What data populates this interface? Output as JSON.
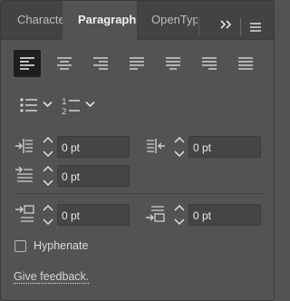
{
  "tabs": {
    "character": "Characte",
    "paragraph": "Paragraph",
    "opentype": "OpenTyp"
  },
  "alignment": {
    "selected": "align-left",
    "buttons": [
      "align-left",
      "align-center",
      "align-right",
      "justify-last-left",
      "justify-last-center",
      "justify-last-right",
      "justify-all"
    ]
  },
  "lists": {
    "bullets_icon": "bulleted-list-icon",
    "numbers_icon": "numbered-list-icon"
  },
  "indents": {
    "left_indent": "0 pt",
    "right_indent": "0 pt",
    "first_line_indent": "0 pt"
  },
  "spacing": {
    "space_before": "0 pt",
    "space_after": "0 pt"
  },
  "hyphenate": {
    "label": "Hyphenate",
    "checked": false
  },
  "feedback": {
    "label": "Give feedback."
  },
  "colors": {
    "panel": "#535353",
    "tabbar": "#434343",
    "selected_button": "#1e1e1e",
    "input_bg": "#454545"
  }
}
